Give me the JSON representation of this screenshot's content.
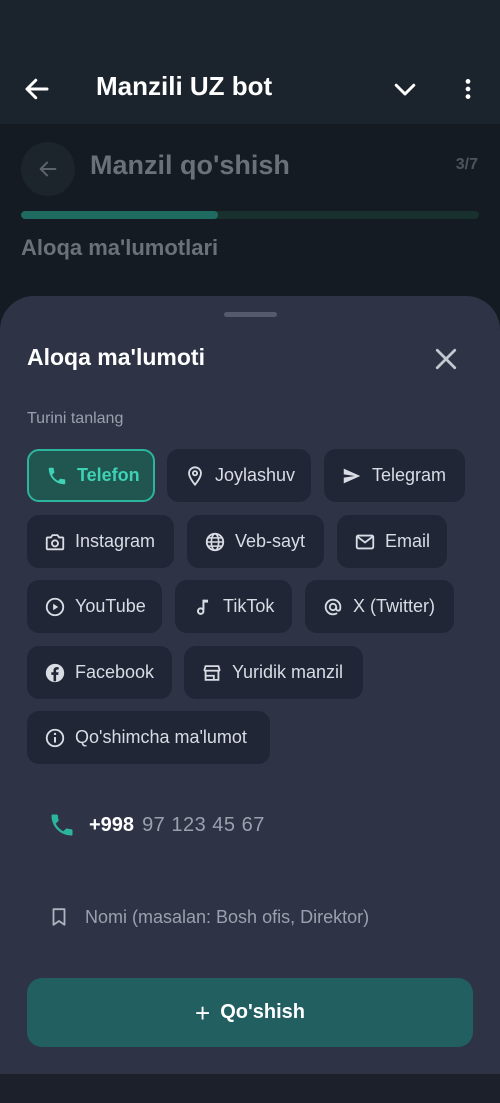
{
  "appbar": {
    "title": "Manzili UZ bot"
  },
  "page": {
    "title": "Manzil qo'shish",
    "step": "3/7",
    "progress": 0.43,
    "subtitle": "Aloqa ma'lumotlari"
  },
  "sheet": {
    "title": "Aloqa ma'lumoti",
    "hint": "Turini tanlang",
    "chips": {
      "telefon": "Telefon",
      "joylashuv": "Joylashuv",
      "telegram": "Telegram",
      "instagram": "Instagram",
      "vebsayt": "Veb-sayt",
      "email": "Email",
      "youtube": "YouTube",
      "tiktok": "TikTok",
      "twitter": "X (Twitter)",
      "facebook": "Facebook",
      "yuridik": "Yuridik manzil",
      "qoshimcha": "Qo'shimcha ma'lumot"
    },
    "selected_chip": "Telefon",
    "phone": {
      "code": "+998",
      "placeholder": "97 123 45 67"
    },
    "name": {
      "placeholder": "Nomi (masalan: Bosh ofis, Direktor)"
    },
    "add_button": {
      "icon": "+",
      "label": "Qo'shish"
    }
  },
  "colors": {
    "accent": "#2bb59e",
    "button": "#215f60",
    "sheet": "#2e3446"
  },
  "icons": [
    "arrow-left-icon",
    "chevron-down-icon",
    "more-vertical-icon",
    "close-icon",
    "phone-icon",
    "location-pin-icon",
    "send-icon",
    "camera-icon",
    "globe-icon",
    "mail-icon",
    "play-circle-icon",
    "music-note-icon",
    "at-sign-icon",
    "facebook-icon",
    "storefront-icon",
    "info-icon",
    "bookmark-icon"
  ]
}
